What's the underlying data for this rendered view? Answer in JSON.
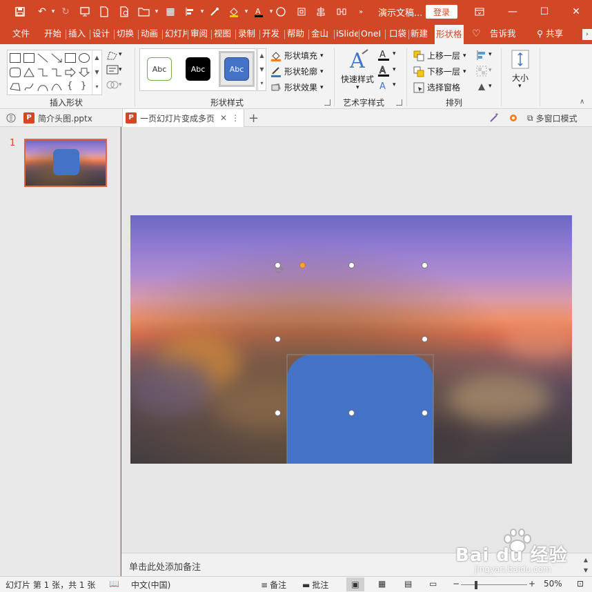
{
  "title_bar": {
    "document_title": "演示文稿...",
    "login_label": "登录"
  },
  "ribbon_tabs": [
    "文件",
    "开始",
    "插入",
    "设计",
    "切换",
    "动画",
    "幻灯片",
    "审阅",
    "视图",
    "录制",
    "开发",
    "帮助",
    "金山",
    "iSlide",
    "OneI",
    "口袋",
    "新建",
    "形状格式",
    "告诉我",
    "共享"
  ],
  "active_tab": "形状格",
  "ribbon": {
    "insert_shapes_label": "插入形状",
    "shape_styles_label": "形状样式",
    "style_sample": "Abc",
    "shape_fill": "形状填充",
    "shape_outline": "形状轮廓",
    "shape_effects": "形状效果",
    "quick_styles": "快速样式",
    "art_text_label": "艺术字样式",
    "bring_forward": "上移一层",
    "send_backward": "下移一层",
    "selection_pane": "选择窗格",
    "arrange_label": "排列",
    "size_label": "大小"
  },
  "doc_tabs": {
    "tab1": "简介头图.pptx",
    "tab2": "一页幻灯片变成多页",
    "multi_window": "多窗口模式"
  },
  "left_panel": {
    "slide_number": "1"
  },
  "notes": {
    "placeholder": "单击此处添加备注"
  },
  "status_bar": {
    "slide_info": "幻灯片 第 1 张，共 1 张",
    "language": "中文(中国)",
    "notes_btn": "备注",
    "comments_btn": "批注",
    "zoom": "50%"
  },
  "watermark": {
    "brand": "Bai du 经验",
    "url": "jingyan.baidu.com"
  },
  "colors": {
    "accent": "#d24726",
    "shape_fill": "#4472c4"
  }
}
